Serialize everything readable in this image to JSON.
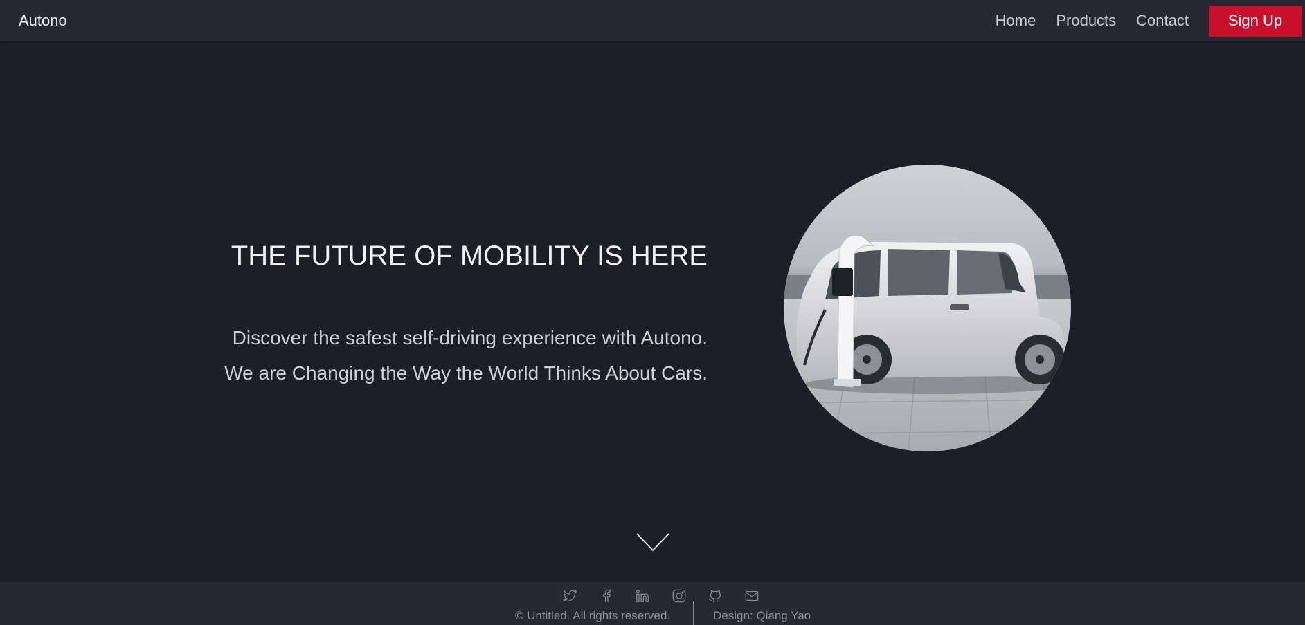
{
  "header": {
    "brand": "Autono",
    "nav": {
      "home": "Home",
      "products": "Products",
      "contact": "Contact"
    },
    "signup_label": "Sign Up",
    "signup_color": "#c8102e"
  },
  "hero": {
    "title": "THE FUTURE OF MOBILITY IS HERE",
    "line1": "Discover the safest self-driving experience with Autono.",
    "line2": "We are Changing the Way the World Thinks About Cars.",
    "image_icon": "electric-car-image"
  },
  "scroll": {
    "icon": "chevron-down-icon"
  },
  "footer": {
    "social_icons": [
      "twitter-icon",
      "facebook-icon",
      "linkedin-icon",
      "instagram-icon",
      "github-icon",
      "email-icon"
    ],
    "copyright": "© Untitled. All rights reserved.",
    "design": "Design: Qiang Yao"
  },
  "colors": {
    "background": "#1e1e28",
    "bar": "#272833",
    "accent": "#c8102e"
  }
}
